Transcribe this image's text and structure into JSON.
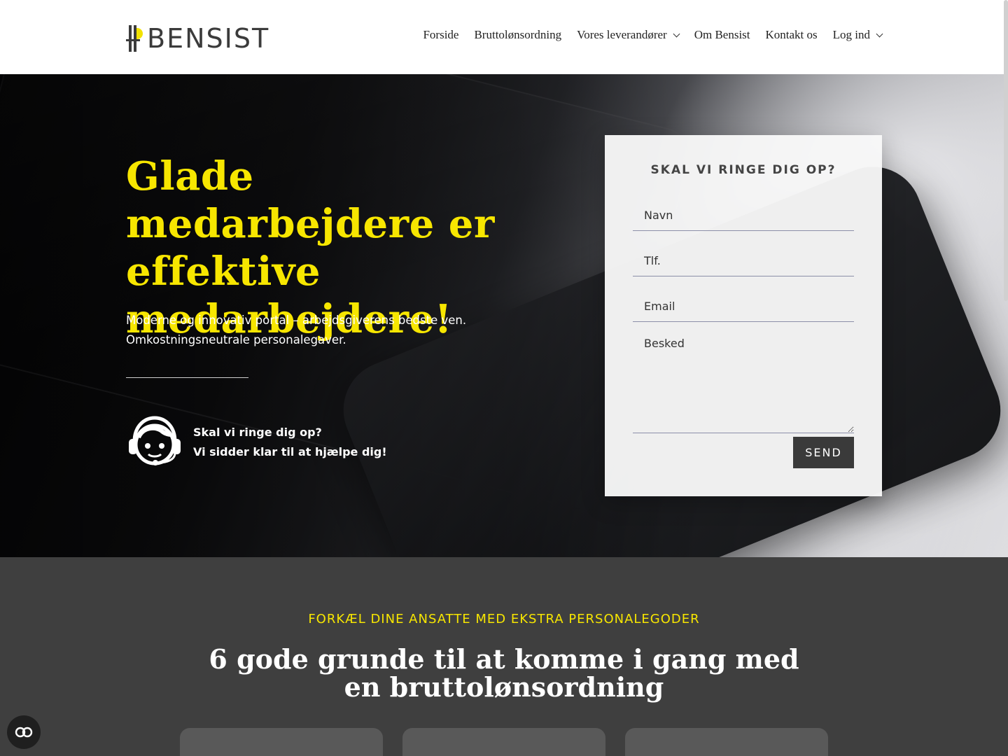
{
  "header": {
    "logo_text": "BENSIST",
    "nav": [
      {
        "label": "Forside",
        "dropdown": false
      },
      {
        "label": "Bruttolønsordning",
        "dropdown": false
      },
      {
        "label": "Vores leverandører",
        "dropdown": true
      },
      {
        "label": "Om Bensist",
        "dropdown": false
      },
      {
        "label": "Kontakt os",
        "dropdown": false
      },
      {
        "label": "Log ind",
        "dropdown": true
      }
    ]
  },
  "hero": {
    "title": "Glade medarbejdere er effektive medarbejdere!",
    "subtitle_lines": [
      "Moderne og innovativ portal – arbejdsgiverens bedste ven.",
      "Omkostningsneutrale personalegaver."
    ],
    "support_icon": "headset-agent-icon",
    "support_lines": [
      "Skal vi ringe dig op?",
      "Vi sidder klar til at hjælpe dig!"
    ]
  },
  "form": {
    "title": "SKAL VI RINGE DIG OP?",
    "name_placeholder": "Navn",
    "phone_placeholder": "Tlf.",
    "email_placeholder": "Email",
    "message_placeholder": "Besked",
    "submit_label": "SEND"
  },
  "section": {
    "kicker": "FORKÆL DINE ANSATTE MED EKSTRA PERSONALEGODER",
    "title": "6 gode grunde til at komme i gang med en bruttolønsordning"
  },
  "accessibility_icon": "accessibility-toggle-icon",
  "colors": {
    "accent_yellow": "#f7e600",
    "dark_section": "#3f3f3f",
    "button_dark": "#3a3a3a"
  }
}
